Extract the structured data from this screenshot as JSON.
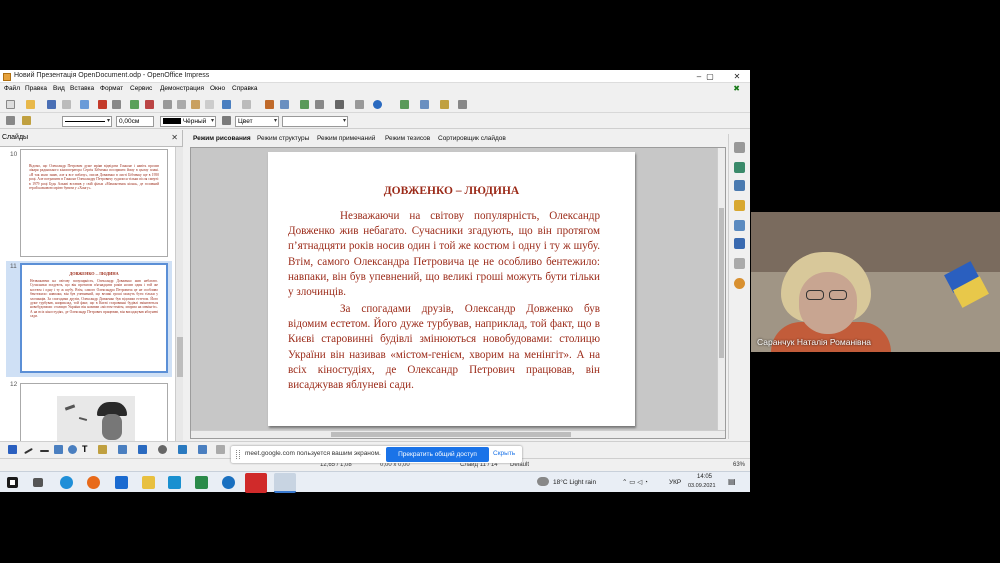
{
  "window": {
    "title": "Новий Презентація OpenDocument.odp - OpenOffice Impress",
    "btn_minimize": "–",
    "btn_maximize": "▢",
    "btn_close": "✕"
  },
  "menu": {
    "items": [
      "Файл",
      "Правка",
      "Вид",
      "Вставка",
      "Формат",
      "Сервис",
      "Демонстрация",
      "Окно",
      "Справка"
    ],
    "close": "✖"
  },
  "toolbar2": {
    "line_width": "0,00см",
    "color_label": "Чёрный",
    "area_style": "Цвет",
    "area_color": ""
  },
  "slides_panel": {
    "title": "Слайды",
    "close": "✕",
    "slide_numbers": [
      "10",
      "11",
      "12"
    ],
    "thumb10_text": "Відомо, що Олександр Петрович дуже мріяв відвідати Гонконг і навіть просив лікаря радянського кінооператора Сергія Бібченка посприяти йому в цьому плані. «Я так мало знаю, але я все побачу», писав Довженко в листі Бібченку ще в 1950 році. Але потрапити в Гонконг Олександру Петровичу судилося тільки після смерті: в 1979 році Будь Алкаві вставив у свій фільм «Мамонтенок кіона», де головний герой казковою мрією бувати у «Хонгу».",
    "thumb11_title": "ДОВЖЕНКО – ЛЮДИНА",
    "thumb11_text": "Незважаючи на світову популярність, Олександр Довженко жив небагато. Сучасники згадують, що він протягом п'ятнадцяти років носив один і той же костюм і одну і ту ж шубу. Втім, самого Олександра Петровича це не особливо бентежило: навпаки, він був упевнений, що великі гроші можуть бути тільки у злочинців. За спогадами друзів, Олександр Довженко був відомим естетом. Його дуже турбував, наприклад, той факт, що в Києві старовинні будівлі змінюються новобудовами: столицю України він називав «містом-генієм, хворим на менінгіт». А на всіх кіностудіях, де Олександр Петрович працював, він висаджував яблуневі сади."
  },
  "view_tabs": [
    "Режим рисования",
    "Режим структуры",
    "Режим примечаний",
    "Режим тезисов",
    "Сортировщик слайдов"
  ],
  "slide": {
    "title": "ДОВЖЕНКО – ЛЮДИНА",
    "paragraph1": "Незважаючи на світову популярність, Олександр Довженко жив небагато. Сучасники згадують, що він протягом п’ятнадцяти років носив один і той же костюм і одну і ту ж шубу. Втім, самого Олександра Петровича це не особливо бентежило: навпаки, він був упевнений, що великі гроші можуть бути тільки у злочинців.",
    "paragraph2": "За спогадами друзів, Олександр Довженко був відомим естетом. Його дуже турбував, наприклад, той факт, що в Києві старовинні будівлі змінюються новобудовами: столицю України він називав «містом-генієм, хворим на менінгіт». А на всіх кіностудіях, де Олександр Петрович працював, він висаджував яблуневі сади."
  },
  "statusbar": {
    "pos": "12,65 / 1,08",
    "size": "0,00 x 0,00",
    "slide": "Слайд 11 / 14",
    "layout": "Default",
    "zoom": "63%"
  },
  "share_banner": {
    "message": "meet.google.com пользуется вашим экраном.",
    "stop_label": "Прекратить общий доступ",
    "hide_label": "Скрыть"
  },
  "taskbar": {
    "weather": "18°C  Light rain",
    "lang": "УКР",
    "time": "14:05",
    "date": "03.09.2021"
  },
  "video": {
    "participant_name": "Саранчук Наталія Романівна"
  },
  "colors": {
    "slide_text": "#9b2a18",
    "accent_blue": "#1a73e8",
    "selection": "#5b8fd6"
  }
}
